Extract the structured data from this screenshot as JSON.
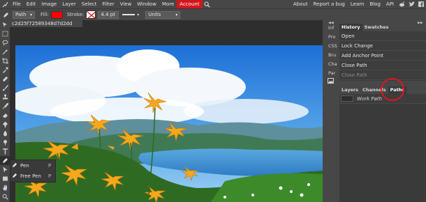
{
  "menu": {
    "items": [
      "File",
      "Edit",
      "Image",
      "Layer",
      "Select",
      "Filter",
      "View",
      "Window",
      "More",
      "Account"
    ],
    "right_items": [
      "About",
      "Report a bug",
      "Learn",
      "Blog",
      "API"
    ],
    "accent_color": "#d2161d"
  },
  "options": {
    "mode": "Path",
    "fill_label": "Fill:",
    "fill_color": "#ff0000",
    "stroke_label": "Stroke:",
    "stroke_width": "4.4 pt",
    "units": "Units"
  },
  "document": {
    "tab_title": "c2d25f72589348d7d2dd"
  },
  "pen_menu": {
    "items": [
      {
        "label": "Pen",
        "key": "P"
      },
      {
        "label": "Free Pen",
        "key": "P"
      }
    ]
  },
  "side_buttons": [
    "Inf",
    "Pro",
    "CSS",
    "Bru",
    "Cha",
    "Par"
  ],
  "history": {
    "tabs": [
      "History",
      "Swatches"
    ],
    "rows": [
      "Open",
      "Lock Change",
      "Add Anchor Point",
      "Close Path",
      "Close Path"
    ]
  },
  "layers": {
    "tabs": [
      "Layers",
      "Channels",
      "Paths"
    ],
    "rows": [
      "Work Path"
    ]
  },
  "highlight_color": "#e0141c"
}
